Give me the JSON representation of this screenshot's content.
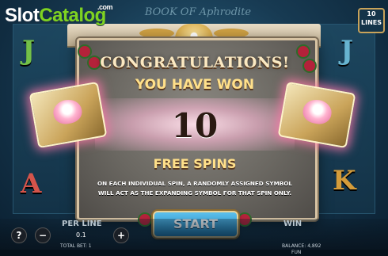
{
  "watermark": {
    "brand_a": "Slot",
    "brand_b": "Catalog",
    "tld": ".com"
  },
  "header": {
    "game_title": "BOOK OF Aphrodite",
    "lines_count": "10",
    "lines_label": "LINES"
  },
  "dialog": {
    "heading": "CONGRATULATIONS!",
    "subheading": "YOU HAVE WON",
    "spins_awarded": "10",
    "award_label": "FREE SPINS",
    "description_line1": "ON EACH INDIVIDUAL SPIN, A RANDOMLY ASSIGNED SYMBOL",
    "description_line2": "WILL ACT AS THE EXPANDING SYMBOL FOR THAT SPIN ONLY.",
    "start_label": "START"
  },
  "reels": {
    "visible_symbols": [
      "J",
      "A",
      "K",
      "J"
    ]
  },
  "bottom_bar": {
    "help_label": "?",
    "minus_label": "−",
    "plus_label": "+",
    "per_line_label": "PER LINE",
    "per_line_value": "0.1",
    "win_label": "WIN",
    "total_bet_text": "TOTAL BET: 1",
    "balance_text": "BALANCE: 4,892",
    "currency": "FUN"
  },
  "colors": {
    "accent_gold": "#ffe08a",
    "start_button": "#1d7fb8",
    "glow_pink": "#ff78aa"
  }
}
